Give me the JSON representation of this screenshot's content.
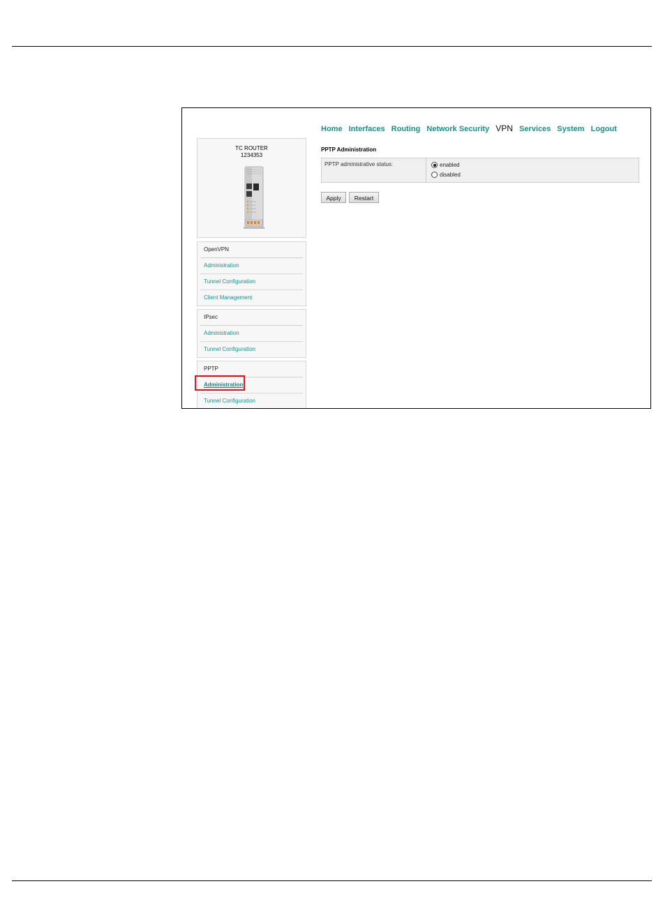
{
  "nav": {
    "items": [
      "Home",
      "Interfaces",
      "Routing",
      "Network Security",
      "VPN",
      "Services",
      "System",
      "Logout"
    ],
    "active": "VPN"
  },
  "device": {
    "name": "TC ROUTER",
    "serial": "1234353"
  },
  "sidebar": {
    "groups": [
      {
        "title": "OpenVPN",
        "items": [
          "Administration",
          "Tunnel Configuration",
          "Client Management"
        ]
      },
      {
        "title": "IPsec",
        "items": [
          "Administration",
          "Tunnel Configuration"
        ]
      },
      {
        "title": "PPTP",
        "items": [
          "Administration",
          "Tunnel Configuration"
        ]
      }
    ],
    "current": "PPTP / Administration"
  },
  "main": {
    "section_title": "PPTP Administration",
    "status_label": "PPTP administrative status:",
    "options": [
      "enabled",
      "disabled"
    ],
    "selected": "enabled",
    "apply_label": "Apply",
    "restart_label": "Restart"
  },
  "colors": {
    "link": "#1a8f8a",
    "highlight": "#e0141e"
  }
}
